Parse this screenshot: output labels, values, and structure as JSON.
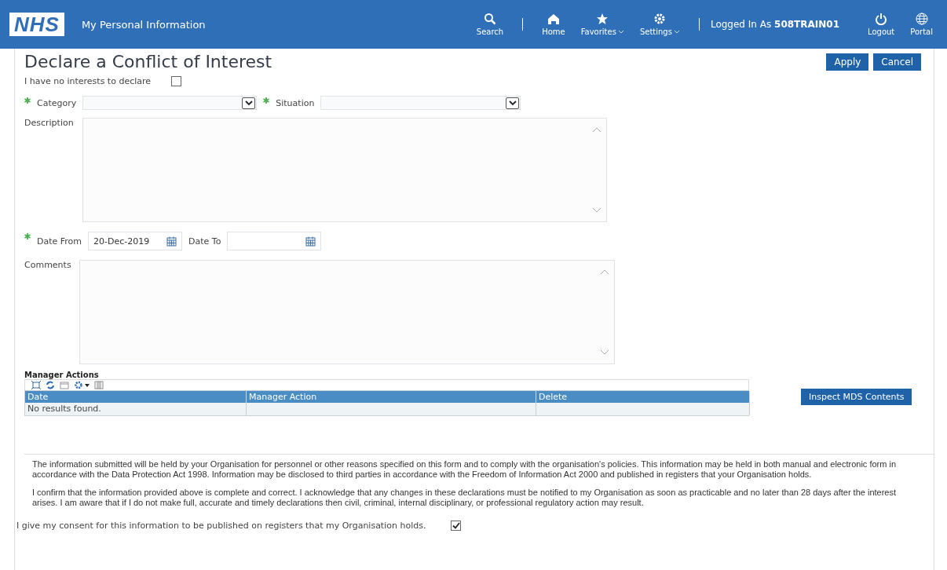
{
  "header": {
    "logo": "NHS",
    "app_title": "My Personal Information",
    "nav": [
      {
        "kind": "search",
        "label": "Search",
        "dropdown": false
      },
      {
        "kind": "home",
        "label": "Home",
        "dropdown": false
      },
      {
        "kind": "star",
        "label": "Favorites",
        "dropdown": true
      },
      {
        "kind": "gear",
        "label": "Settings",
        "dropdown": true
      }
    ],
    "logged_in_label": "Logged In As",
    "user": "508TRAIN01",
    "actions": [
      {
        "kind": "power",
        "label": "Logout"
      },
      {
        "kind": "globe",
        "label": "Portal"
      }
    ]
  },
  "page_title": "Declare a Conflict of Interest",
  "buttons": [
    "Apply",
    "Cancel"
  ],
  "no_interests": {
    "label": "I have no interests to declare",
    "checked": false
  },
  "category": {
    "label": "Category",
    "required": true
  },
  "situation": {
    "label": "Situation",
    "required": true
  },
  "description": {
    "label": "Description"
  },
  "date_from": {
    "label": "Date From",
    "value": "20-Dec-2019",
    "required": true
  },
  "date_to": {
    "label": "Date To",
    "required": false
  },
  "comments": {
    "label": "Comments"
  },
  "manager_actions": {
    "title": "Manager Actions",
    "columns": [
      "Date",
      "Manager Action",
      "Delete"
    ],
    "empty_message": "No results found."
  },
  "inspect_button": "Inspect MDS Contents",
  "disclaimer": [
    "The information submitted will be held by your Organisation for personnel or other reasons specified on this form and to comply with the organisation's policies. This information may be held in both manual and electronic form in accordance with the Data Protection Act 1998. Information may be disclosed to third parties in accordance with the Freedom of Information Act 2000 and published in registers that your Organisation holds.",
    "I confirm that the information provided above is complete and correct. I acknowledge that any changes in these declarations must be notified to my Organisation as soon as practicable and no later than 28 days after the interest arises. I am aware that if I do not make full, accurate and timely declarations then civil, criminal, internal disciplinary, or professional regulatory action may result."
  ],
  "consent": {
    "label": "I give my consent for this information to be published on registers that my Organisation holds.",
    "checked": true
  }
}
